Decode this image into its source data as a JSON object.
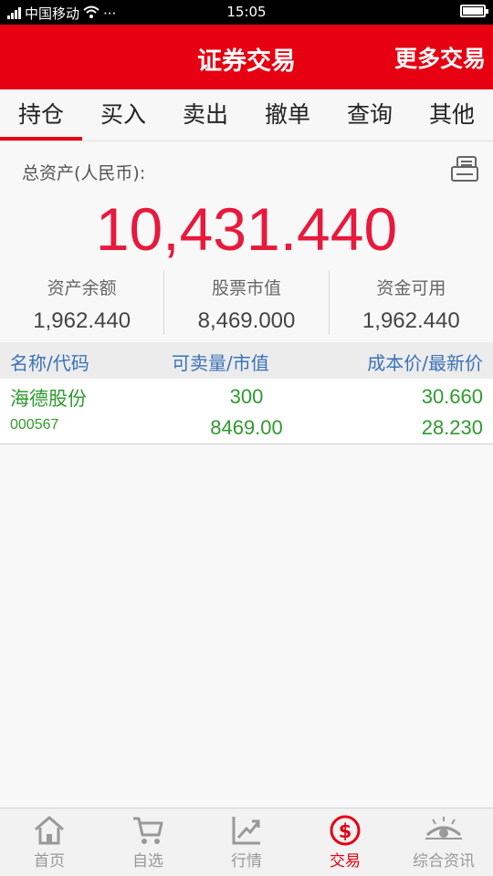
{
  "status_bar": {
    "carrier": "中国移动",
    "dots": "···",
    "time": "15:05"
  },
  "header": {
    "title": "证券交易",
    "more": "更多交易"
  },
  "tabs": [
    {
      "label": "持仓",
      "active": true
    },
    {
      "label": "买入"
    },
    {
      "label": "卖出"
    },
    {
      "label": "撤单"
    },
    {
      "label": "查询"
    },
    {
      "label": "其他"
    }
  ],
  "assets": {
    "total_label": "总资产(人民币):",
    "total_value": "10,431.440",
    "subs": [
      {
        "label": "资产余额",
        "value": "1,962.440"
      },
      {
        "label": "股票市值",
        "value": "8,469.000"
      },
      {
        "label": "资金可用",
        "value": "1,962.440"
      }
    ]
  },
  "table": {
    "headers": [
      "名称/代码",
      "可卖量/市值",
      "成本价/最新价"
    ],
    "rows": [
      {
        "name": "海德股份",
        "code": "000567",
        "qty": "300",
        "market_value": "8469.00",
        "cost": "30.660",
        "last": "28.230"
      }
    ]
  },
  "bottom_nav": [
    {
      "label": "首页",
      "icon": "home-icon"
    },
    {
      "label": "自选",
      "icon": "cart-icon"
    },
    {
      "label": "行情",
      "icon": "chart-icon"
    },
    {
      "label": "交易",
      "icon": "dollar-icon",
      "active": true
    },
    {
      "label": "综合资讯",
      "icon": "eye-icon"
    }
  ],
  "colors": {
    "brand_red": "#e60012",
    "total_red": "#e8193c",
    "gain_green": "#2e9b2e",
    "header_blue": "#3a73b8"
  }
}
